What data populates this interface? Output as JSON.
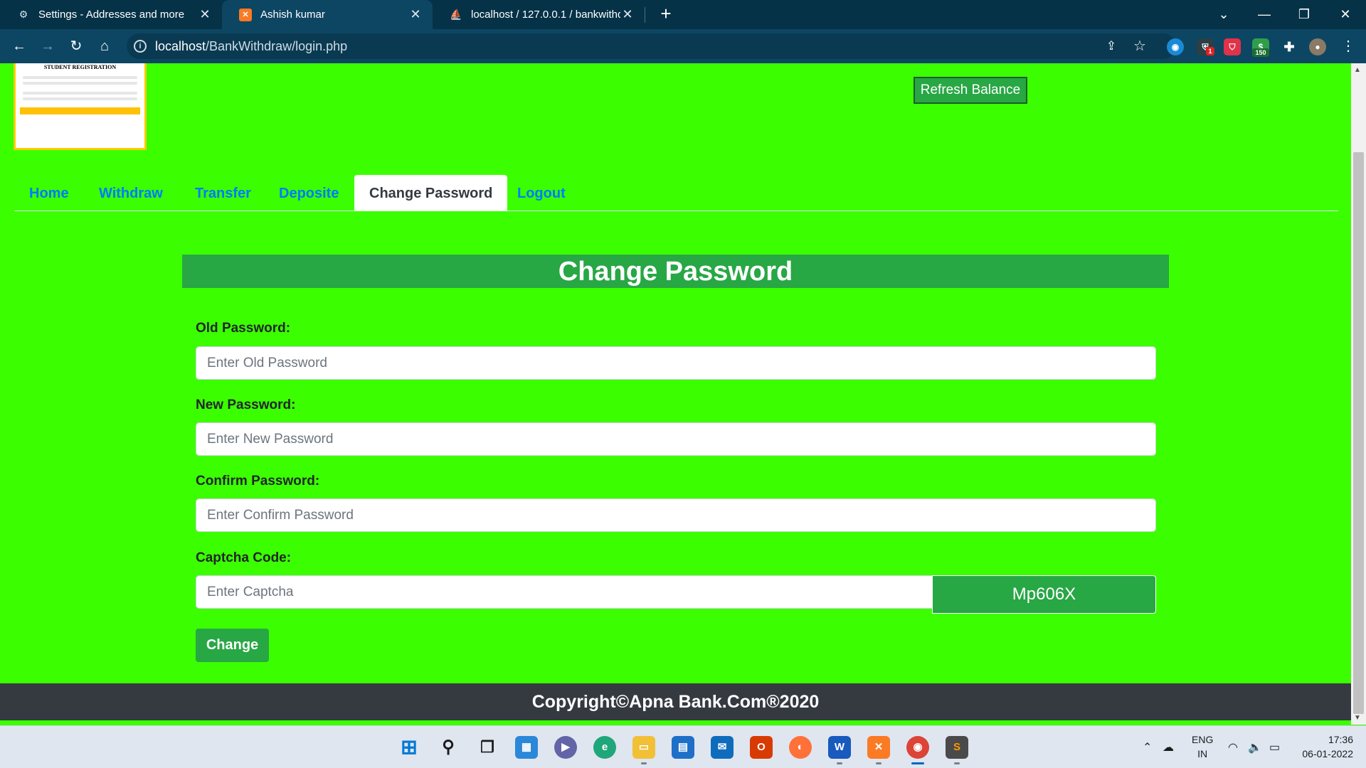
{
  "browser": {
    "tabs": [
      {
        "title": "Settings - Addresses and more",
        "icon": "gear-icon",
        "active": false
      },
      {
        "title": "Ashish kumar",
        "icon": "xampp-icon",
        "active": true
      },
      {
        "title": "localhost / 127.0.0.1 / bankwithd",
        "icon": "phpmyadmin-icon",
        "active": false
      }
    ],
    "url_host": "localhost",
    "url_path": "/BankWithdraw/login.php",
    "extensions": {
      "shield_badge": "1",
      "ext_badge": "150"
    }
  },
  "header": {
    "logo_title": "STUDENT REGISTRATION",
    "refresh_label": "Refresh Balance"
  },
  "nav": {
    "items": [
      {
        "label": "Home"
      },
      {
        "label": "Withdraw"
      },
      {
        "label": "Transfer"
      },
      {
        "label": "Deposite"
      },
      {
        "label": "Change Password",
        "active": true
      },
      {
        "label": "Logout"
      }
    ]
  },
  "form": {
    "title": "Change Password",
    "old_label": "Old Password:",
    "old_placeholder": "Enter Old Password",
    "new_label": "New Password:",
    "new_placeholder": "Enter New Password",
    "confirm_label": "Confirm Password:",
    "confirm_placeholder": "Enter Confirm Password",
    "captcha_label": "Captcha Code:",
    "captcha_placeholder": "Enter Captcha",
    "captcha_value": "Mp606X",
    "submit_label": "Change"
  },
  "footer": {
    "text": "Copyright©Apna Bank.Com®2020"
  },
  "taskbar": {
    "lang_line1": "ENG",
    "lang_line2": "IN",
    "time": "17:36",
    "date": "06-01-2022"
  },
  "colors": {
    "page_bg": "#3bff00",
    "accent_green": "#28a745",
    "link_blue": "#007bff",
    "footer_bg": "#343a40"
  }
}
